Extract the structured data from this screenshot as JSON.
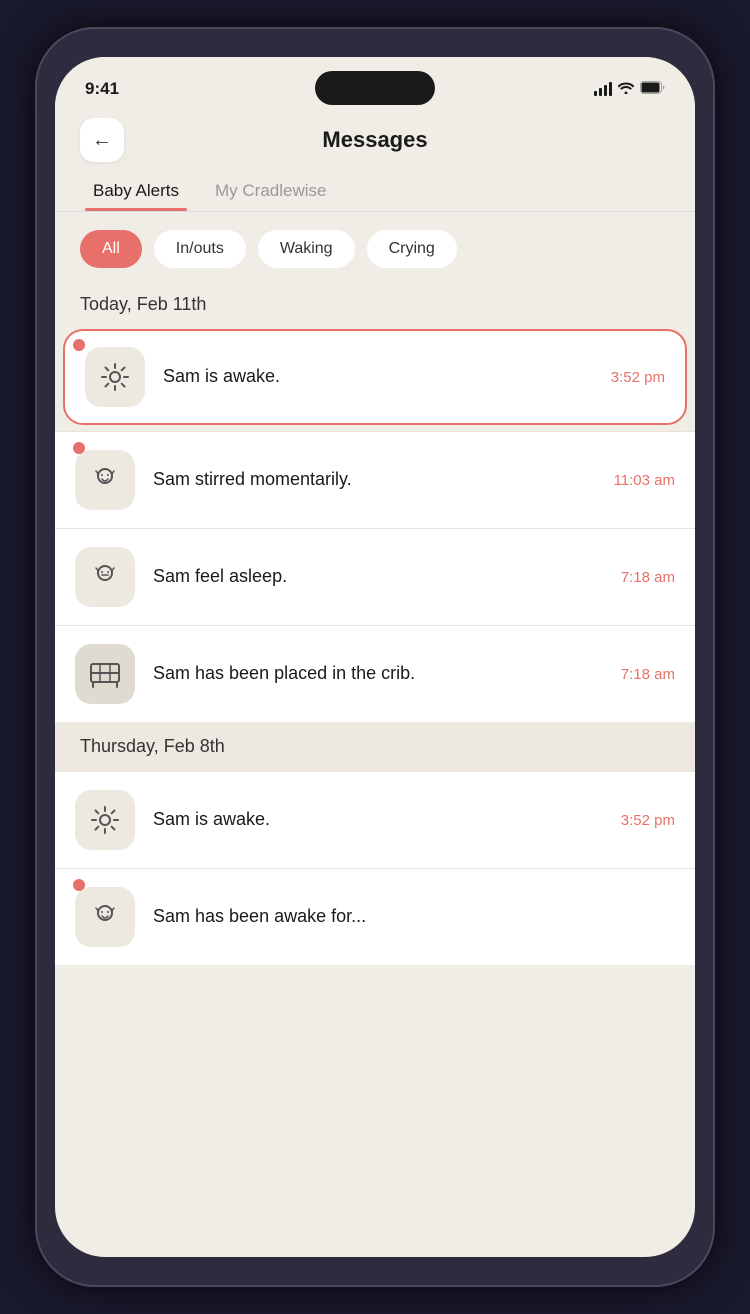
{
  "statusBar": {
    "time": "9:41"
  },
  "header": {
    "title": "Messages",
    "backLabel": "←"
  },
  "tabs": [
    {
      "label": "Baby Alerts",
      "active": true
    },
    {
      "label": "My Cradlewise",
      "active": false
    }
  ],
  "chips": [
    {
      "label": "All",
      "active": true
    },
    {
      "label": "In/outs",
      "active": false
    },
    {
      "label": "Waking",
      "active": false
    },
    {
      "label": "Crying",
      "active": false
    }
  ],
  "sections": [
    {
      "dateLabel": "Today, Feb 11th",
      "messages": [
        {
          "text": "Sam is awake.",
          "time": "3:52 pm",
          "icon": "sun",
          "highlighted": true,
          "unread": true
        },
        {
          "text": "Sam stirred momentarily.",
          "time": "11:03 am",
          "icon": "baby",
          "highlighted": false,
          "unread": true
        },
        {
          "text": "Sam feel asleep.",
          "time": "7:18 am",
          "icon": "baby-sleep",
          "highlighted": false,
          "unread": false
        },
        {
          "text": "Sam has been placed in the crib.",
          "time": "7:18 am",
          "icon": "crib",
          "highlighted": false,
          "unread": false
        }
      ]
    },
    {
      "dateLabel": "Thursday, Feb 8th",
      "messages": [
        {
          "text": "Sam is awake.",
          "time": "3:52 pm",
          "icon": "sun",
          "highlighted": false,
          "unread": false
        },
        {
          "text": "Sam has been awake for...",
          "time": "",
          "icon": "baby",
          "highlighted": false,
          "unread": false,
          "partial": true
        }
      ]
    }
  ]
}
